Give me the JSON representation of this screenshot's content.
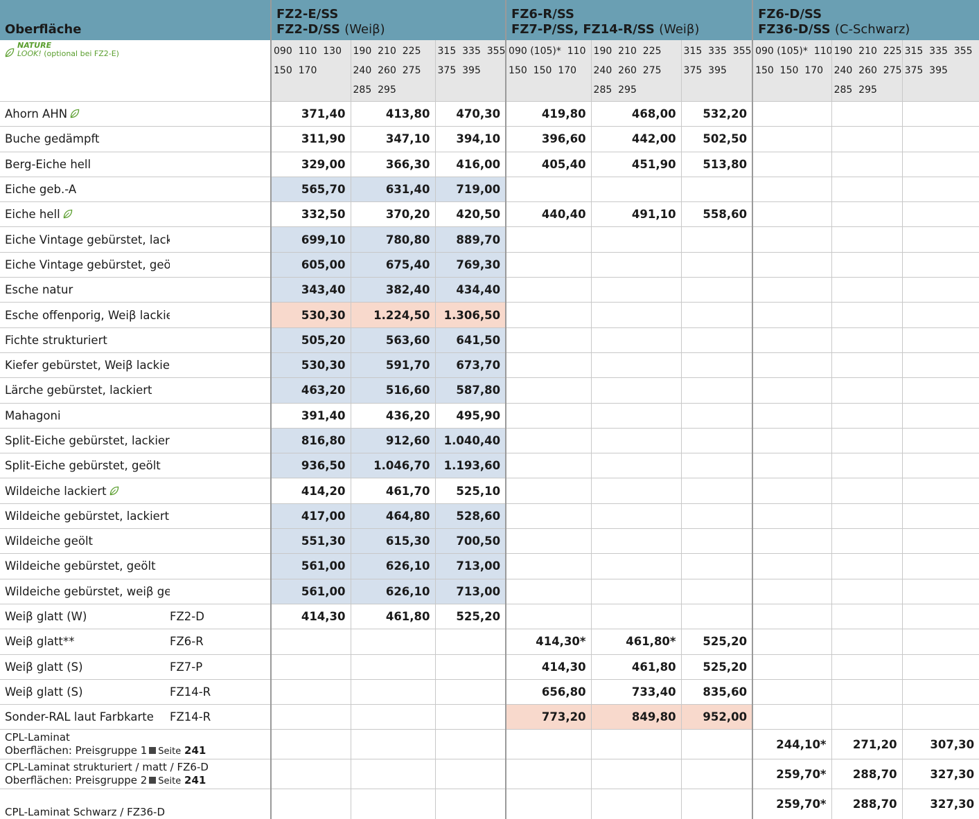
{
  "header": {
    "surface_title": "Oberfläche",
    "groups": [
      {
        "line1": "FZ2-E/SS",
        "line2": "FZ2-D/SS",
        "line2_note": "(Weiβ)"
      },
      {
        "line1": "FZ6-R/SS",
        "line2": "FZ7-P/SS, FZ14-R/SS",
        "line2_note": "(Weiβ)"
      },
      {
        "line1": "FZ6-D/SS",
        "line2": "FZ36-D/SS",
        "line2_note": "(C-Schwarz)"
      }
    ]
  },
  "nature": {
    "title1": "NATURE",
    "title2": "LOOK!",
    "note": "(optional bei FZ2-E)"
  },
  "sizes": [
    "090  110  130\n150  170",
    "190  210  225\n240  260  275\n285  295",
    "315  335  355\n375  395",
    "090 (105)*  110\n150  150  170",
    "190  210  225\n240  260  275\n285  295",
    "315  335  355\n375  395",
    "090 (105)*  110\n150  150  170",
    "190  210  225\n240  260  275\n285  295",
    "315  335  355\n375  395"
  ],
  "rows": [
    {
      "label": "Ahorn AHN",
      "leaf": true,
      "sub": "",
      "v": [
        "371,40",
        "413,80",
        "470,30",
        "419,80",
        "468,00",
        "532,20",
        "",
        "",
        ""
      ],
      "bg": [
        "w",
        "w",
        "w",
        "w",
        "w",
        "w",
        "w",
        "w",
        "w"
      ]
    },
    {
      "label": "Buche gedämpft",
      "leaf": false,
      "sub": "",
      "v": [
        "311,90",
        "347,10",
        "394,10",
        "396,60",
        "442,00",
        "502,50",
        "",
        "",
        ""
      ],
      "bg": [
        "w",
        "w",
        "w",
        "w",
        "w",
        "w",
        "w",
        "w",
        "w"
      ]
    },
    {
      "label": "Berg-Eiche hell",
      "leaf": false,
      "sub": "",
      "v": [
        "329,00",
        "366,30",
        "416,00",
        "405,40",
        "451,90",
        "513,80",
        "",
        "",
        ""
      ],
      "bg": [
        "w",
        "w",
        "w",
        "w",
        "w",
        "w",
        "w",
        "w",
        "w"
      ]
    },
    {
      "label": "Eiche geb.-A",
      "leaf": false,
      "sub": "",
      "v": [
        "565,70",
        "631,40",
        "719,00",
        "",
        "",
        "",
        "",
        "",
        ""
      ],
      "bg": [
        "b",
        "b",
        "b",
        "w",
        "w",
        "w",
        "w",
        "w",
        "w"
      ]
    },
    {
      "label": "Eiche hell",
      "leaf": true,
      "sub": "",
      "v": [
        "332,50",
        "370,20",
        "420,50",
        "440,40",
        "491,10",
        "558,60",
        "",
        "",
        ""
      ],
      "bg": [
        "w",
        "w",
        "w",
        "w",
        "w",
        "w",
        "w",
        "w",
        "w"
      ]
    },
    {
      "label": "Eiche Vintage gebürstet, lackiert",
      "leaf": true,
      "sub": "",
      "v": [
        "699,10",
        "780,80",
        "889,70",
        "",
        "",
        "",
        "",
        "",
        ""
      ],
      "bg": [
        "b",
        "b",
        "b",
        "w",
        "w",
        "w",
        "w",
        "w",
        "w"
      ]
    },
    {
      "label": "Eiche Vintage gebürstet, geölt",
      "leaf": false,
      "sub": "",
      "v": [
        "605,00",
        "675,40",
        "769,30",
        "",
        "",
        "",
        "",
        "",
        ""
      ],
      "bg": [
        "b",
        "b",
        "b",
        "w",
        "w",
        "w",
        "w",
        "w",
        "w"
      ]
    },
    {
      "label": "Esche natur",
      "leaf": false,
      "sub": "",
      "v": [
        "343,40",
        "382,40",
        "434,40",
        "",
        "",
        "",
        "",
        "",
        ""
      ],
      "bg": [
        "b",
        "b",
        "b",
        "w",
        "w",
        "w",
        "w",
        "w",
        "w"
      ]
    },
    {
      "label": "Esche offenporig, Weiβ lackiert",
      "leaf": false,
      "sub": "",
      "v": [
        "530,30",
        "1.224,50",
        "1.306,50",
        "",
        "",
        "",
        "",
        "",
        ""
      ],
      "bg": [
        "p",
        "p",
        "p",
        "w",
        "w",
        "w",
        "w",
        "w",
        "w"
      ]
    },
    {
      "label": "Fichte strukturiert",
      "leaf": false,
      "sub": "",
      "v": [
        "505,20",
        "563,60",
        "641,50",
        "",
        "",
        "",
        "",
        "",
        ""
      ],
      "bg": [
        "b",
        "b",
        "b",
        "w",
        "w",
        "w",
        "w",
        "w",
        "w"
      ]
    },
    {
      "label": "Kiefer gebürstet, Weiβ lackiert",
      "leaf": false,
      "sub": "",
      "v": [
        "530,30",
        "591,70",
        "673,70",
        "",
        "",
        "",
        "",
        "",
        ""
      ],
      "bg": [
        "b",
        "b",
        "b",
        "w",
        "w",
        "w",
        "w",
        "w",
        "w"
      ]
    },
    {
      "label": "Lärche gebürstet, lackiert",
      "leaf": false,
      "sub": "",
      "v": [
        "463,20",
        "516,60",
        "587,80",
        "",
        "",
        "",
        "",
        "",
        ""
      ],
      "bg": [
        "b",
        "b",
        "b",
        "w",
        "w",
        "w",
        "w",
        "w",
        "w"
      ]
    },
    {
      "label": "Mahagoni",
      "leaf": false,
      "sub": "",
      "v": [
        "391,40",
        "436,20",
        "495,90",
        "",
        "",
        "",
        "",
        "",
        ""
      ],
      "bg": [
        "w",
        "w",
        "w",
        "w",
        "w",
        "w",
        "w",
        "w",
        "w"
      ]
    },
    {
      "label": "Split-Eiche gebürstet, lackiert",
      "leaf": true,
      "sub": "",
      "v": [
        "816,80",
        "912,60",
        "1.040,40",
        "",
        "",
        "",
        "",
        "",
        ""
      ],
      "bg": [
        "b",
        "b",
        "b",
        "w",
        "w",
        "w",
        "w",
        "w",
        "w"
      ]
    },
    {
      "label": "Split-Eiche gebürstet, geölt",
      "leaf": false,
      "sub": "",
      "v": [
        "936,50",
        "1.046,70",
        "1.193,60",
        "",
        "",
        "",
        "",
        "",
        ""
      ],
      "bg": [
        "b",
        "b",
        "b",
        "w",
        "w",
        "w",
        "w",
        "w",
        "w"
      ]
    },
    {
      "label": "Wildeiche lackiert",
      "leaf": true,
      "sub": "",
      "v": [
        "414,20",
        "461,70",
        "525,10",
        "",
        "",
        "",
        "",
        "",
        ""
      ],
      "bg": [
        "w",
        "w",
        "w",
        "w",
        "w",
        "w",
        "w",
        "w",
        "w"
      ]
    },
    {
      "label": "Wildeiche gebürstet, lackiert",
      "leaf": true,
      "sub": "",
      "v": [
        "417,00",
        "464,80",
        "528,60",
        "",
        "",
        "",
        "",
        "",
        ""
      ],
      "bg": [
        "b",
        "b",
        "b",
        "w",
        "w",
        "w",
        "w",
        "w",
        "w"
      ]
    },
    {
      "label": "Wildeiche geölt",
      "leaf": false,
      "sub": "",
      "v": [
        "551,30",
        "615,30",
        "700,50",
        "",
        "",
        "",
        "",
        "",
        ""
      ],
      "bg": [
        "b",
        "b",
        "b",
        "w",
        "w",
        "w",
        "w",
        "w",
        "w"
      ]
    },
    {
      "label": "Wildeiche gebürstet, geölt",
      "leaf": false,
      "sub": "",
      "v": [
        "561,00",
        "626,10",
        "713,00",
        "",
        "",
        "",
        "",
        "",
        ""
      ],
      "bg": [
        "b",
        "b",
        "b",
        "w",
        "w",
        "w",
        "w",
        "w",
        "w"
      ]
    },
    {
      "label": "Wildeiche gebürstet, weiβ geölt",
      "leaf": false,
      "sub": "",
      "v": [
        "561,00",
        "626,10",
        "713,00",
        "",
        "",
        "",
        "",
        "",
        ""
      ],
      "bg": [
        "b",
        "b",
        "b",
        "w",
        "w",
        "w",
        "w",
        "w",
        "w"
      ]
    },
    {
      "label": "Weiβ glatt (W)",
      "leaf": false,
      "sub": "FZ2-D",
      "v": [
        "414,30",
        "461,80",
        "525,20",
        "",
        "",
        "",
        "",
        "",
        ""
      ],
      "bg": [
        "w",
        "w",
        "w",
        "w",
        "w",
        "w",
        "w",
        "w",
        "w"
      ]
    },
    {
      "label": "Weiβ glatt**",
      "leaf": false,
      "sub": "FZ6-R",
      "v": [
        "",
        "",
        "",
        "414,30*",
        "461,80*",
        "525,20",
        "",
        "",
        ""
      ],
      "bg": [
        "w",
        "w",
        "w",
        "w",
        "w",
        "w",
        "w",
        "w",
        "w"
      ]
    },
    {
      "label": "Weiβ glatt (S)",
      "leaf": false,
      "sub": "FZ7-P",
      "v": [
        "",
        "",
        "",
        "414,30",
        "461,80",
        "525,20",
        "",
        "",
        ""
      ],
      "bg": [
        "w",
        "w",
        "w",
        "w",
        "w",
        "w",
        "w",
        "w",
        "w"
      ]
    },
    {
      "label": "Weiβ glatt (S)",
      "leaf": false,
      "sub": "FZ14-R",
      "v": [
        "",
        "",
        "",
        "656,80",
        "733,40",
        "835,60",
        "",
        "",
        ""
      ],
      "bg": [
        "w",
        "w",
        "w",
        "w",
        "w",
        "w",
        "w",
        "w",
        "w"
      ]
    },
    {
      "label": "Sonder-RAL laut Farbkarte",
      "leaf": false,
      "sub": "FZ14-R",
      "v": [
        "",
        "",
        "",
        "773,20",
        "849,80",
        "952,00",
        "",
        "",
        ""
      ],
      "bg": [
        "w",
        "w",
        "w",
        "p",
        "p",
        "p",
        "w",
        "w",
        "w"
      ]
    }
  ],
  "cpl_rows": [
    {
      "line1": "CPL-Laminat",
      "line2": "Oberflächen: Preisgruppe 1",
      "page_label": "Seite",
      "page": "241",
      "v": [
        "244,10*",
        "271,20",
        "307,30"
      ]
    },
    {
      "line1": "CPL-Laminat strukturiert / matt / FZ6-D",
      "line2": "Oberflächen: Preisgruppe 2",
      "page_label": "Seite",
      "page": "241",
      "v": [
        "259,70*",
        "288,70",
        "327,30"
      ]
    },
    {
      "line1": "CPL-Laminat Schwarz / FZ36-D",
      "line2": "",
      "page_label": "",
      "page": "",
      "v": [
        "259,70*",
        "288,70",
        "327,30"
      ]
    }
  ],
  "colors": {
    "header": "#6a9fb3",
    "blue_cell": "#d5e0ed",
    "pink_cell": "#f8d9cc",
    "size_row": "#e6e6e6",
    "leaf": "#5a9e2e"
  }
}
